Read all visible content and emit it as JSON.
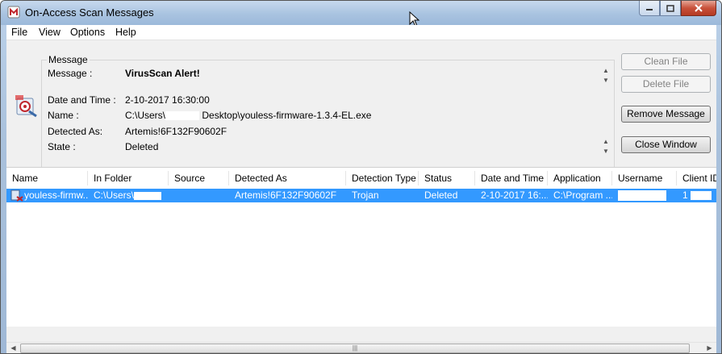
{
  "window": {
    "title": "On-Access Scan Messages"
  },
  "menubar": {
    "items": [
      "File",
      "View",
      "Options",
      "Help"
    ]
  },
  "message": {
    "group_label": "Message",
    "message_label": "Message :",
    "message_value": "VirusScan  Alert!",
    "date_label": "Date and Time :",
    "date_value": "2-10-2017 16:30:00",
    "name_label": "Name :",
    "name_value_prefix": "C:\\Users\\",
    "name_value_suffix": " Desktop\\youless-firmware-1.3.4-EL.exe",
    "detected_label": "Detected As:",
    "detected_value": "Artemis!6F132F90602F",
    "state_label": "State :",
    "state_value": "Deleted"
  },
  "buttons": {
    "clean_file": "Clean File",
    "delete_file": "Delete File",
    "remove_message": "Remove Message",
    "close_window": "Close Window"
  },
  "list": {
    "columns": [
      "Name",
      "In Folder",
      "Source",
      "Detected As",
      "Detection Type",
      "Status",
      "Date and Time",
      "Application",
      "Username",
      "Client ID"
    ],
    "rows": [
      {
        "name": "youless-firmw...",
        "in_folder": "C:\\Users\\",
        "source": "",
        "detected_as": "Artemis!6F132F90602F",
        "detection_type": "Trojan",
        "status": "Deleted",
        "date_time": "2-10-2017 16:...",
        "application": "C:\\Program ...",
        "username": "",
        "client_id": "1"
      }
    ]
  },
  "colors": {
    "selection": "#3399ff",
    "titlebar": "#a9c3e0"
  }
}
